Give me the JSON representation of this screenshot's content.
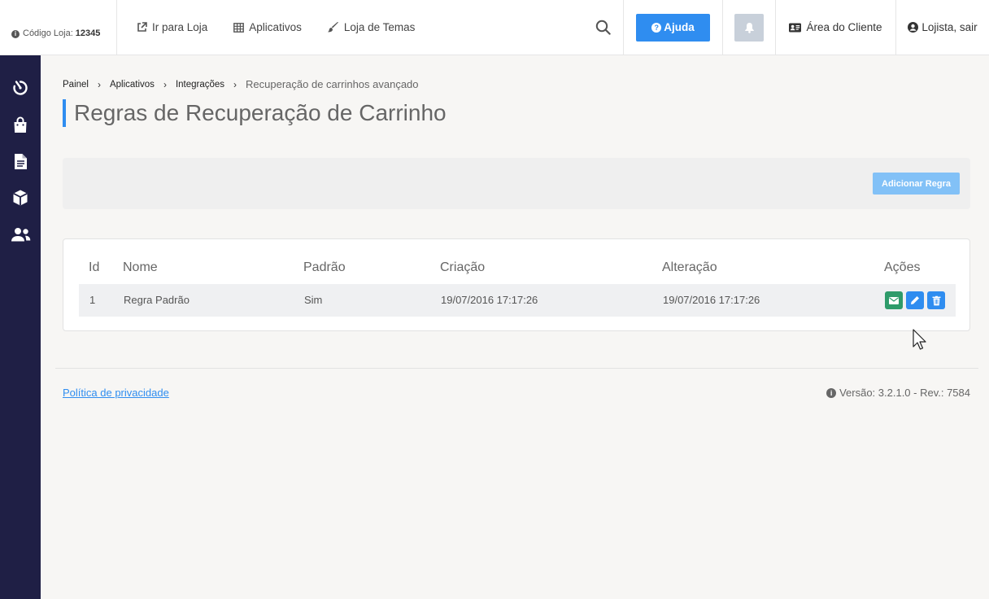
{
  "header": {
    "store_code_label": "Código Loja:",
    "store_code_value": "12345",
    "nav": [
      {
        "label": "Ir para Loja",
        "icon": "external-link-icon"
      },
      {
        "label": "Aplicativos",
        "icon": "grid-icon"
      },
      {
        "label": "Loja de Temas",
        "icon": "brush-icon"
      }
    ],
    "help_label": "Ajuda",
    "client_area_label": "Área do Cliente",
    "user_label": "Lojista, sair"
  },
  "sidebar": {
    "items": [
      {
        "icon": "dashboard-timer-icon"
      },
      {
        "icon": "shopping-bag-icon"
      },
      {
        "icon": "document-icon"
      },
      {
        "icon": "box-icon"
      },
      {
        "icon": "users-icon"
      }
    ]
  },
  "breadcrumb": {
    "items": [
      "Painel",
      "Aplicativos",
      "Integrações"
    ],
    "current": "Recuperação de carrinhos avançado"
  },
  "page_title": "Regras de Recuperação de Carrinho",
  "actions": {
    "add_rule_label": "Adicionar Regra"
  },
  "table": {
    "headers": [
      "Id",
      "Nome",
      "Padrão",
      "Criação",
      "Alteração",
      "Ações"
    ],
    "rows": [
      {
        "id": "1",
        "name": "Regra Padrão",
        "default": "Sim",
        "created": "19/07/2016 17:17:26",
        "updated": "19/07/2016 17:17:26"
      }
    ]
  },
  "footer": {
    "privacy_label": "Política de privacidade",
    "version_text": "Versão: 3.2.1.0 - Rev.: 7584"
  },
  "colors": {
    "accent": "#2f8df0",
    "sidebar": "#1f1f45",
    "email_action": "#2e9b6a",
    "edit_action": "#2f8df0",
    "delete_action": "#2f8df0"
  }
}
